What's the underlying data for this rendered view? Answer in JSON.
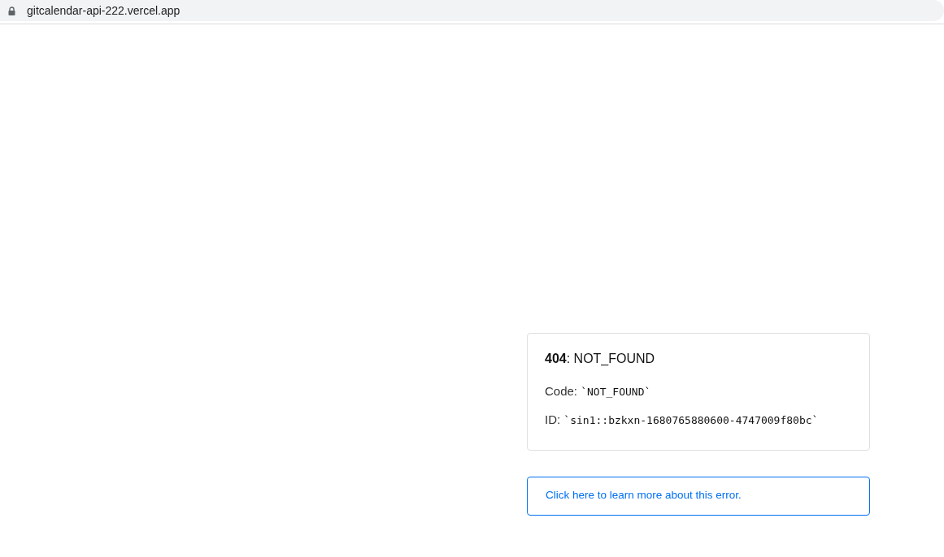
{
  "address_bar": {
    "url": "gitcalendar-api-222.vercel.app"
  },
  "error": {
    "title": "**404**: NOT_FOUND",
    "code_label": "Code:",
    "code_value": "`NOT_FOUND`",
    "id_label": "ID:",
    "id_value": "`sin1::bzkxn-1680765880600-4747009f80bc`"
  },
  "help_link": "Click here to learn more about this error."
}
